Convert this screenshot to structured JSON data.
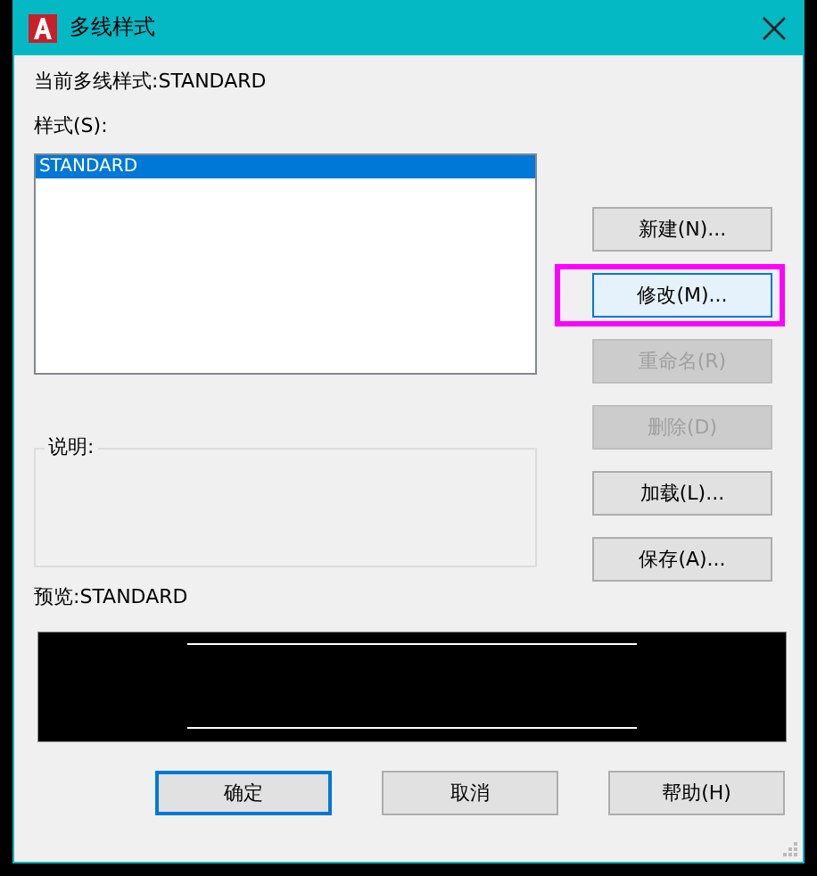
{
  "window": {
    "title": "多线样式"
  },
  "current_style": "当前多线样式:STANDARD",
  "styles": {
    "label": "样式(S):",
    "items": [
      {
        "label": "STANDARD",
        "selected": true
      }
    ]
  },
  "description": {
    "label": "说明:"
  },
  "preview": {
    "label": "预览:STANDARD"
  },
  "side_buttons": [
    {
      "label": "新建(N)...",
      "disabled": false,
      "focused": false,
      "highlighted": false
    },
    {
      "label": "修改(M)...",
      "disabled": false,
      "focused": true,
      "highlighted": true
    },
    {
      "label": "重命名(R)",
      "disabled": true,
      "focused": false,
      "highlighted": false
    },
    {
      "label": "删除(D)",
      "disabled": true,
      "focused": false,
      "highlighted": false
    },
    {
      "label": "加载(L)...",
      "disabled": false,
      "focused": false,
      "highlighted": false
    },
    {
      "label": "保存(A)...",
      "disabled": false,
      "focused": false,
      "highlighted": false
    }
  ],
  "bottom_buttons": [
    {
      "label": "确定",
      "default": true
    },
    {
      "label": "取消",
      "default": false
    },
    {
      "label": "帮助(H)",
      "default": false
    }
  ]
}
